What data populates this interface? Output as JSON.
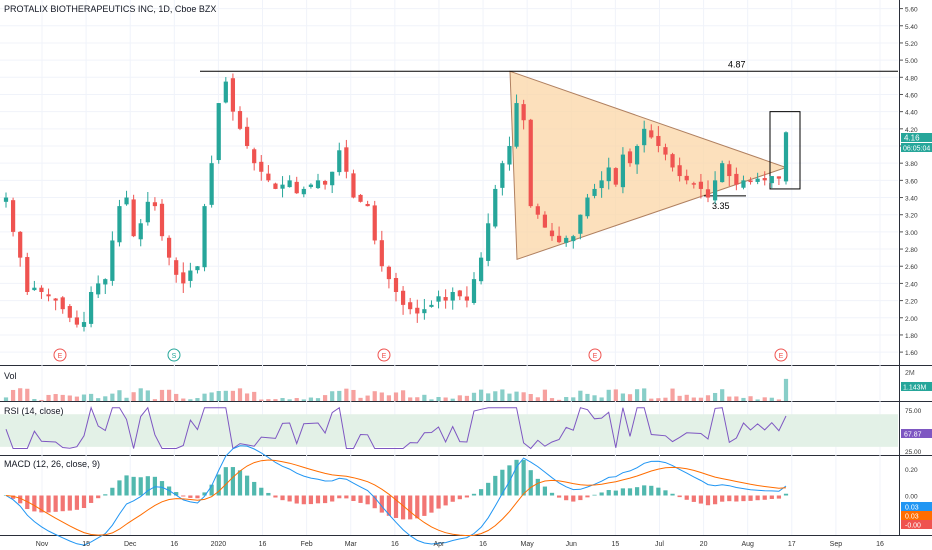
{
  "header": {
    "symbol_title": "PROTALIX BIOTHERAPEUTICS INC, 1D, Cboe BZX"
  },
  "price_axis": {
    "ticks": [
      "1.60",
      "1.80",
      "2.00",
      "2.20",
      "2.40",
      "2.60",
      "2.80",
      "3.00",
      "3.20",
      "3.40",
      "3.60",
      "3.80",
      "4.00",
      "4.20",
      "4.40",
      "4.60",
      "4.80",
      "5.00",
      "5.20",
      "5.40",
      "5.60"
    ],
    "last_price": "4.16",
    "countdown": "06:05:04"
  },
  "time_axis": {
    "labels": [
      "Nov",
      "15",
      "Dec",
      "16",
      "2020",
      "16",
      "Feb",
      "Mar",
      "16",
      "Apr",
      "16",
      "May",
      "Jun",
      "15",
      "Jul",
      "20",
      "Aug",
      "17",
      "Sep",
      "16"
    ]
  },
  "annotations": {
    "resistance_label": "4.87",
    "support_label": "3.35",
    "event_markers": [
      "E",
      "S",
      "E",
      "E",
      "E"
    ]
  },
  "volume_pane": {
    "label": "Vol",
    "axis_label": "2M",
    "last_value": "1.143M"
  },
  "rsi_pane": {
    "label": "RSI (14, close)",
    "axis_ticks": [
      "75.00",
      "50.00",
      "25.00"
    ],
    "last_value": "67.87"
  },
  "macd_pane": {
    "label": "MACD (12, 26, close, 9)",
    "axis_ticks": [
      "0.20",
      "0.00",
      "-0.20"
    ],
    "values": [
      "0.03",
      "0.03",
      "-0.00"
    ]
  },
  "colors": {
    "up": "#26a69a",
    "down": "#ef5350",
    "triangle_fill": "#fbd5a5",
    "rsi_band": "#e3f1e7",
    "rsi_line": "#7e57c2",
    "macd_line": "#2196f3",
    "signal_line": "#ff6d00"
  },
  "chart_data": [
    {
      "type": "candlestick",
      "title": "PROTALIX BIOTHERAPEUTICS INC, 1D, Cboe BZX",
      "ylim": [
        1.45,
        5.7
      ],
      "x_labels": [
        "Nov",
        "15",
        "Dec",
        "16",
        "2020",
        "16",
        "Feb",
        "Mar",
        "16",
        "Apr",
        "16",
        "May",
        "Jun",
        "15",
        "Jul",
        "20",
        "Aug",
        "17",
        "Sep",
        "16"
      ],
      "approx_close_series": [
        3.4,
        3.0,
        2.7,
        2.3,
        2.35,
        2.3,
        2.25,
        2.2,
        2.1,
        2.0,
        1.92,
        1.95,
        2.3,
        2.4,
        2.45,
        2.9,
        3.3,
        3.4,
        2.95,
        3.1,
        3.35,
        3.3,
        2.95,
        2.7,
        2.5,
        2.4,
        2.55,
        2.6,
        3.3,
        3.8,
        4.5,
        4.75,
        4.4,
        4.2,
        4.0,
        3.8,
        3.7,
        3.6,
        3.5,
        3.55,
        3.6,
        3.45,
        3.5,
        3.55,
        3.6,
        3.55,
        3.7,
        3.95,
        3.7,
        3.4,
        3.35,
        3.3,
        2.9,
        2.6,
        2.45,
        2.3,
        2.15,
        2.1,
        2.05,
        2.1,
        2.15,
        2.25,
        2.2,
        2.3,
        2.25,
        2.2,
        2.45,
        2.7,
        3.1,
        3.5,
        3.8,
        4.0,
        4.5,
        4.3,
        3.3,
        3.2,
        3.05,
        2.95,
        2.88,
        2.93,
        2.95,
        3.2,
        3.4,
        3.5,
        3.6,
        3.75,
        3.55,
        3.9,
        3.8,
        4.0,
        4.2,
        4.1,
        4.0,
        3.9,
        3.75,
        3.65,
        3.6,
        3.55,
        3.5,
        3.4,
        3.6,
        3.8,
        3.65,
        3.55,
        3.6,
        3.58,
        3.62,
        3.6,
        3.65,
        3.62,
        4.16
      ],
      "resistance_level": 4.87,
      "support_level": 3.35,
      "triangle_vertices": [
        [
          0.5,
          4.87
        ],
        [
          0.5,
          2.68
        ],
        [
          0.84,
          3.75
        ]
      ],
      "events": [
        "E",
        "S",
        "E",
        "E",
        "E"
      ]
    },
    {
      "type": "bar",
      "title": "Vol",
      "last_value": "1.143M"
    },
    {
      "type": "line",
      "title": "RSI (14, close)",
      "ylim": [
        20,
        85
      ],
      "band": [
        30,
        70
      ],
      "last_value": 67.87
    },
    {
      "type": "line",
      "title": "MACD (12, 26, close, 9)",
      "ylim": [
        -0.3,
        0.3
      ],
      "series": [
        {
          "name": "MACD",
          "last_value": 0.03
        },
        {
          "name": "Signal",
          "last_value": 0.03
        },
        {
          "name": "Histogram",
          "last_value": -0.0
        }
      ]
    }
  ]
}
